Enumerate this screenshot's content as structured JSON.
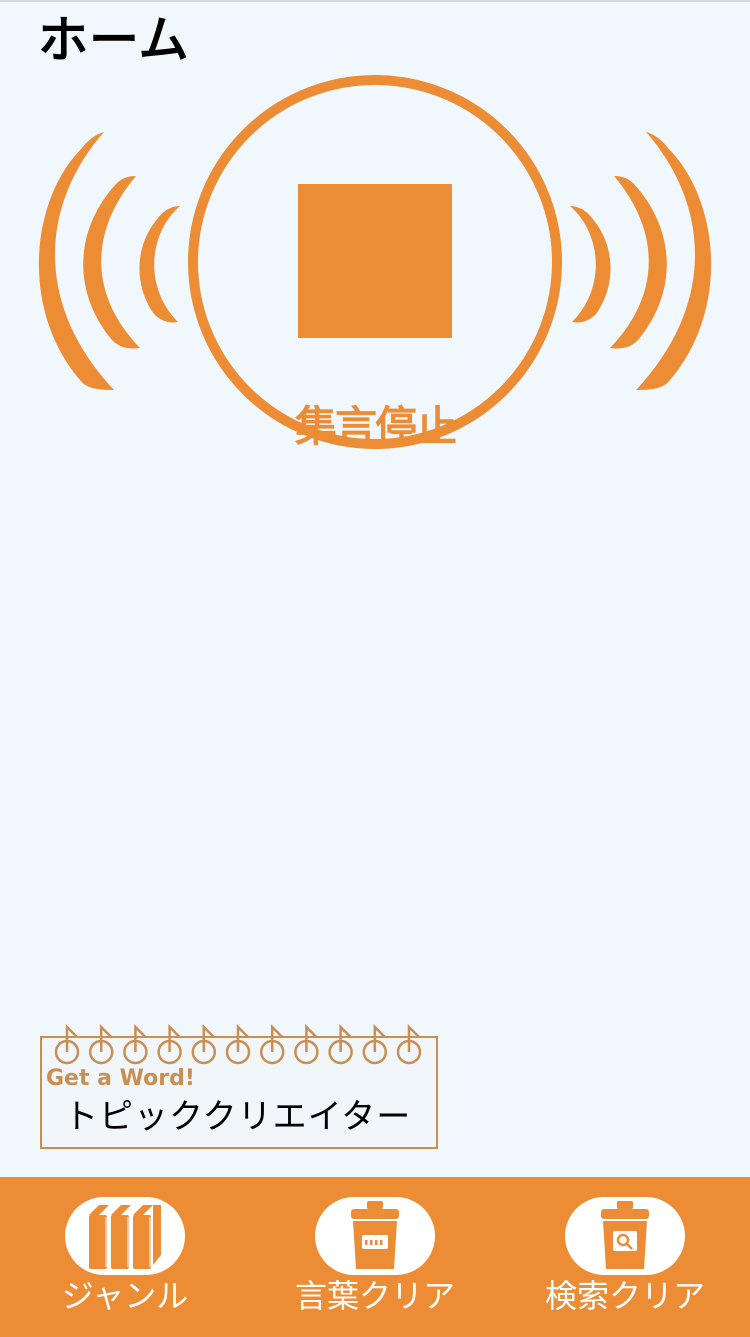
{
  "header": {
    "title": "ホーム"
  },
  "record": {
    "label": "集言停止",
    "state": "recording",
    "icon": "stop-icon"
  },
  "topic_card": {
    "brand": "Get a Word!",
    "name": "トピッククリエイター"
  },
  "tabs": [
    {
      "label": "ジャンル",
      "icon": "books-icon"
    },
    {
      "label": "言葉クリア",
      "icon": "trash-icon"
    },
    {
      "label": "検索クリア",
      "icon": "search-trash-icon"
    }
  ],
  "colors": {
    "accent": "#ec8c34",
    "background": "#f1f8fd",
    "card_border": "#c98f52",
    "text": "#000000",
    "tab_text": "#ffffff"
  }
}
